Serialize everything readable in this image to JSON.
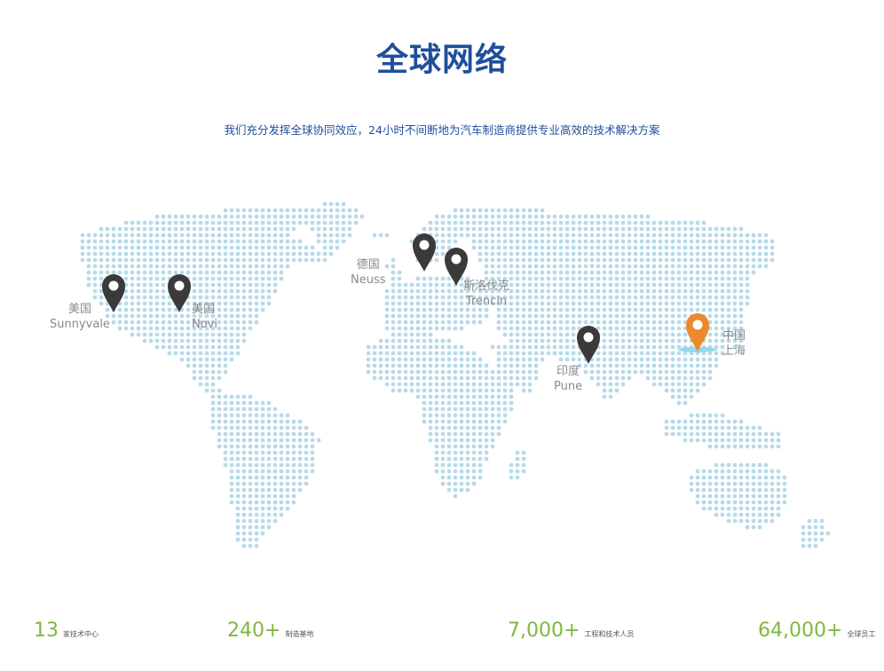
{
  "title": "全球网络",
  "subtitle": "我们充分发挥全球协同效应，24小时不间断地为汽车制造商提供专业高效的技术解决方案",
  "colors": {
    "title": "#1f4e9c",
    "dot": "#b8dae8",
    "pin": "#3a3a3a",
    "pin_highlight": "#e98a2c",
    "label": "#8a8a8a",
    "stat_number": "#7fb83e"
  },
  "locations": [
    {
      "name": "美国",
      "city": "Sunnyvale",
      "icon": "map-pin-icon"
    },
    {
      "name": "美国",
      "city": "Novi",
      "icon": "map-pin-icon"
    },
    {
      "name": "德国",
      "city": "Neuss",
      "icon": "map-pin-icon"
    },
    {
      "name": "斯洛伐克",
      "city": "Trencin",
      "icon": "map-pin-icon"
    },
    {
      "name": "印度",
      "city": "Pune",
      "icon": "map-pin-icon"
    },
    {
      "name": "中国",
      "city": "上海",
      "icon": "map-pin-highlight-icon"
    }
  ],
  "stats": [
    {
      "number": "13",
      "label": "家技术中心"
    },
    {
      "number": "240+",
      "label": "制造基地"
    },
    {
      "number": "7,000+",
      "label": "工程和技术人员"
    },
    {
      "number": "64,000+",
      "label": "全球员工"
    }
  ]
}
